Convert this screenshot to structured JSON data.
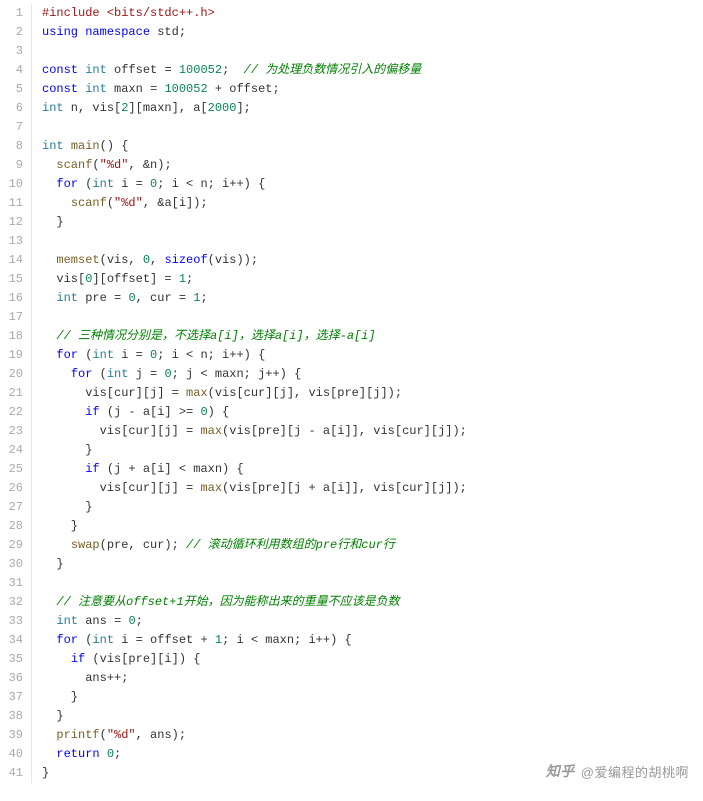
{
  "watermark": {
    "logo": "知乎",
    "text": "@爱编程的胡桃啊"
  },
  "code": {
    "lines": [
      [
        {
          "t": "#include",
          "c": "tok-pp"
        },
        {
          "t": " "
        },
        {
          "t": "<bits/stdc++.h>",
          "c": "tok-pp"
        }
      ],
      [
        {
          "t": "using",
          "c": "tok-kw"
        },
        {
          "t": " "
        },
        {
          "t": "namespace",
          "c": "tok-kw"
        },
        {
          "t": " std;"
        }
      ],
      [],
      [
        {
          "t": "const",
          "c": "tok-kw"
        },
        {
          "t": " "
        },
        {
          "t": "int",
          "c": "tok-type"
        },
        {
          "t": " offset = "
        },
        {
          "t": "100052",
          "c": "tok-num"
        },
        {
          "t": ";  "
        },
        {
          "t": "// 为处理负数情况引入的偏移量",
          "c": "tok-cmt"
        }
      ],
      [
        {
          "t": "const",
          "c": "tok-kw"
        },
        {
          "t": " "
        },
        {
          "t": "int",
          "c": "tok-type"
        },
        {
          "t": " maxn = "
        },
        {
          "t": "100052",
          "c": "tok-num"
        },
        {
          "t": " + offset;"
        }
      ],
      [
        {
          "t": "int",
          "c": "tok-type"
        },
        {
          "t": " n, vis["
        },
        {
          "t": "2",
          "c": "tok-num"
        },
        {
          "t": "][maxn], a["
        },
        {
          "t": "2000",
          "c": "tok-num"
        },
        {
          "t": "];"
        }
      ],
      [],
      [
        {
          "t": "int",
          "c": "tok-type"
        },
        {
          "t": " "
        },
        {
          "t": "main",
          "c": "tok-fn"
        },
        {
          "t": "() {"
        }
      ],
      [
        {
          "t": "  "
        },
        {
          "t": "scanf",
          "c": "tok-fn"
        },
        {
          "t": "("
        },
        {
          "t": "\"%d\"",
          "c": "tok-str"
        },
        {
          "t": ", &n);"
        }
      ],
      [
        {
          "t": "  "
        },
        {
          "t": "for",
          "c": "tok-kw"
        },
        {
          "t": " ("
        },
        {
          "t": "int",
          "c": "tok-type"
        },
        {
          "t": " i = "
        },
        {
          "t": "0",
          "c": "tok-num"
        },
        {
          "t": "; i < n; i++) {"
        }
      ],
      [
        {
          "t": "    "
        },
        {
          "t": "scanf",
          "c": "tok-fn"
        },
        {
          "t": "("
        },
        {
          "t": "\"%d\"",
          "c": "tok-str"
        },
        {
          "t": ", &a[i]);"
        }
      ],
      [
        {
          "t": "  }"
        }
      ],
      [],
      [
        {
          "t": "  "
        },
        {
          "t": "memset",
          "c": "tok-fn"
        },
        {
          "t": "(vis, "
        },
        {
          "t": "0",
          "c": "tok-num"
        },
        {
          "t": ", "
        },
        {
          "t": "sizeof",
          "c": "tok-kw"
        },
        {
          "t": "(vis));"
        }
      ],
      [
        {
          "t": "  vis["
        },
        {
          "t": "0",
          "c": "tok-num"
        },
        {
          "t": "][offset] = "
        },
        {
          "t": "1",
          "c": "tok-num"
        },
        {
          "t": ";"
        }
      ],
      [
        {
          "t": "  "
        },
        {
          "t": "int",
          "c": "tok-type"
        },
        {
          "t": " pre = "
        },
        {
          "t": "0",
          "c": "tok-num"
        },
        {
          "t": ", cur = "
        },
        {
          "t": "1",
          "c": "tok-num"
        },
        {
          "t": ";"
        }
      ],
      [],
      [
        {
          "t": "  "
        },
        {
          "t": "// 三种情况分别是，不选择a[i]，选择a[i]，选择-a[i]",
          "c": "tok-cmt"
        }
      ],
      [
        {
          "t": "  "
        },
        {
          "t": "for",
          "c": "tok-kw"
        },
        {
          "t": " ("
        },
        {
          "t": "int",
          "c": "tok-type"
        },
        {
          "t": " i = "
        },
        {
          "t": "0",
          "c": "tok-num"
        },
        {
          "t": "; i < n; i++) {"
        }
      ],
      [
        {
          "t": "    "
        },
        {
          "t": "for",
          "c": "tok-kw"
        },
        {
          "t": " ("
        },
        {
          "t": "int",
          "c": "tok-type"
        },
        {
          "t": " j = "
        },
        {
          "t": "0",
          "c": "tok-num"
        },
        {
          "t": "; j < maxn; j++) {"
        }
      ],
      [
        {
          "t": "      vis[cur][j] = "
        },
        {
          "t": "max",
          "c": "tok-fn"
        },
        {
          "t": "(vis[cur][j], vis[pre][j]);"
        }
      ],
      [
        {
          "t": "      "
        },
        {
          "t": "if",
          "c": "tok-kw"
        },
        {
          "t": " (j - a[i] >= "
        },
        {
          "t": "0",
          "c": "tok-num"
        },
        {
          "t": ") {"
        }
      ],
      [
        {
          "t": "        vis[cur][j] = "
        },
        {
          "t": "max",
          "c": "tok-fn"
        },
        {
          "t": "(vis[pre][j - a[i]], vis[cur][j]);"
        }
      ],
      [
        {
          "t": "      }"
        }
      ],
      [
        {
          "t": "      "
        },
        {
          "t": "if",
          "c": "tok-kw"
        },
        {
          "t": " (j + a[i] < maxn) {"
        }
      ],
      [
        {
          "t": "        vis[cur][j] = "
        },
        {
          "t": "max",
          "c": "tok-fn"
        },
        {
          "t": "(vis[pre][j + a[i]], vis[cur][j]);"
        }
      ],
      [
        {
          "t": "      }"
        }
      ],
      [
        {
          "t": "    }"
        }
      ],
      [
        {
          "t": "    "
        },
        {
          "t": "swap",
          "c": "tok-fn"
        },
        {
          "t": "(pre, cur); "
        },
        {
          "t": "// 滚动循环利用数组的pre行和cur行",
          "c": "tok-cmt"
        }
      ],
      [
        {
          "t": "  }"
        }
      ],
      [],
      [
        {
          "t": "  "
        },
        {
          "t": "// 注意要从offset+1开始，因为能称出来的重量不应该是负数",
          "c": "tok-cmt"
        }
      ],
      [
        {
          "t": "  "
        },
        {
          "t": "int",
          "c": "tok-type"
        },
        {
          "t": " ans = "
        },
        {
          "t": "0",
          "c": "tok-num"
        },
        {
          "t": ";"
        }
      ],
      [
        {
          "t": "  "
        },
        {
          "t": "for",
          "c": "tok-kw"
        },
        {
          "t": " ("
        },
        {
          "t": "int",
          "c": "tok-type"
        },
        {
          "t": " i = offset + "
        },
        {
          "t": "1",
          "c": "tok-num"
        },
        {
          "t": "; i < maxn; i++) {"
        }
      ],
      [
        {
          "t": "    "
        },
        {
          "t": "if",
          "c": "tok-kw"
        },
        {
          "t": " (vis[pre][i]) {"
        }
      ],
      [
        {
          "t": "      ans++;"
        }
      ],
      [
        {
          "t": "    }"
        }
      ],
      [
        {
          "t": "  }"
        }
      ],
      [
        {
          "t": "  "
        },
        {
          "t": "printf",
          "c": "tok-fn"
        },
        {
          "t": "("
        },
        {
          "t": "\"%d\"",
          "c": "tok-str"
        },
        {
          "t": ", ans);"
        }
      ],
      [
        {
          "t": "  "
        },
        {
          "t": "return",
          "c": "tok-kw"
        },
        {
          "t": " "
        },
        {
          "t": "0",
          "c": "tok-num"
        },
        {
          "t": ";"
        }
      ],
      [
        {
          "t": "}"
        }
      ]
    ]
  }
}
